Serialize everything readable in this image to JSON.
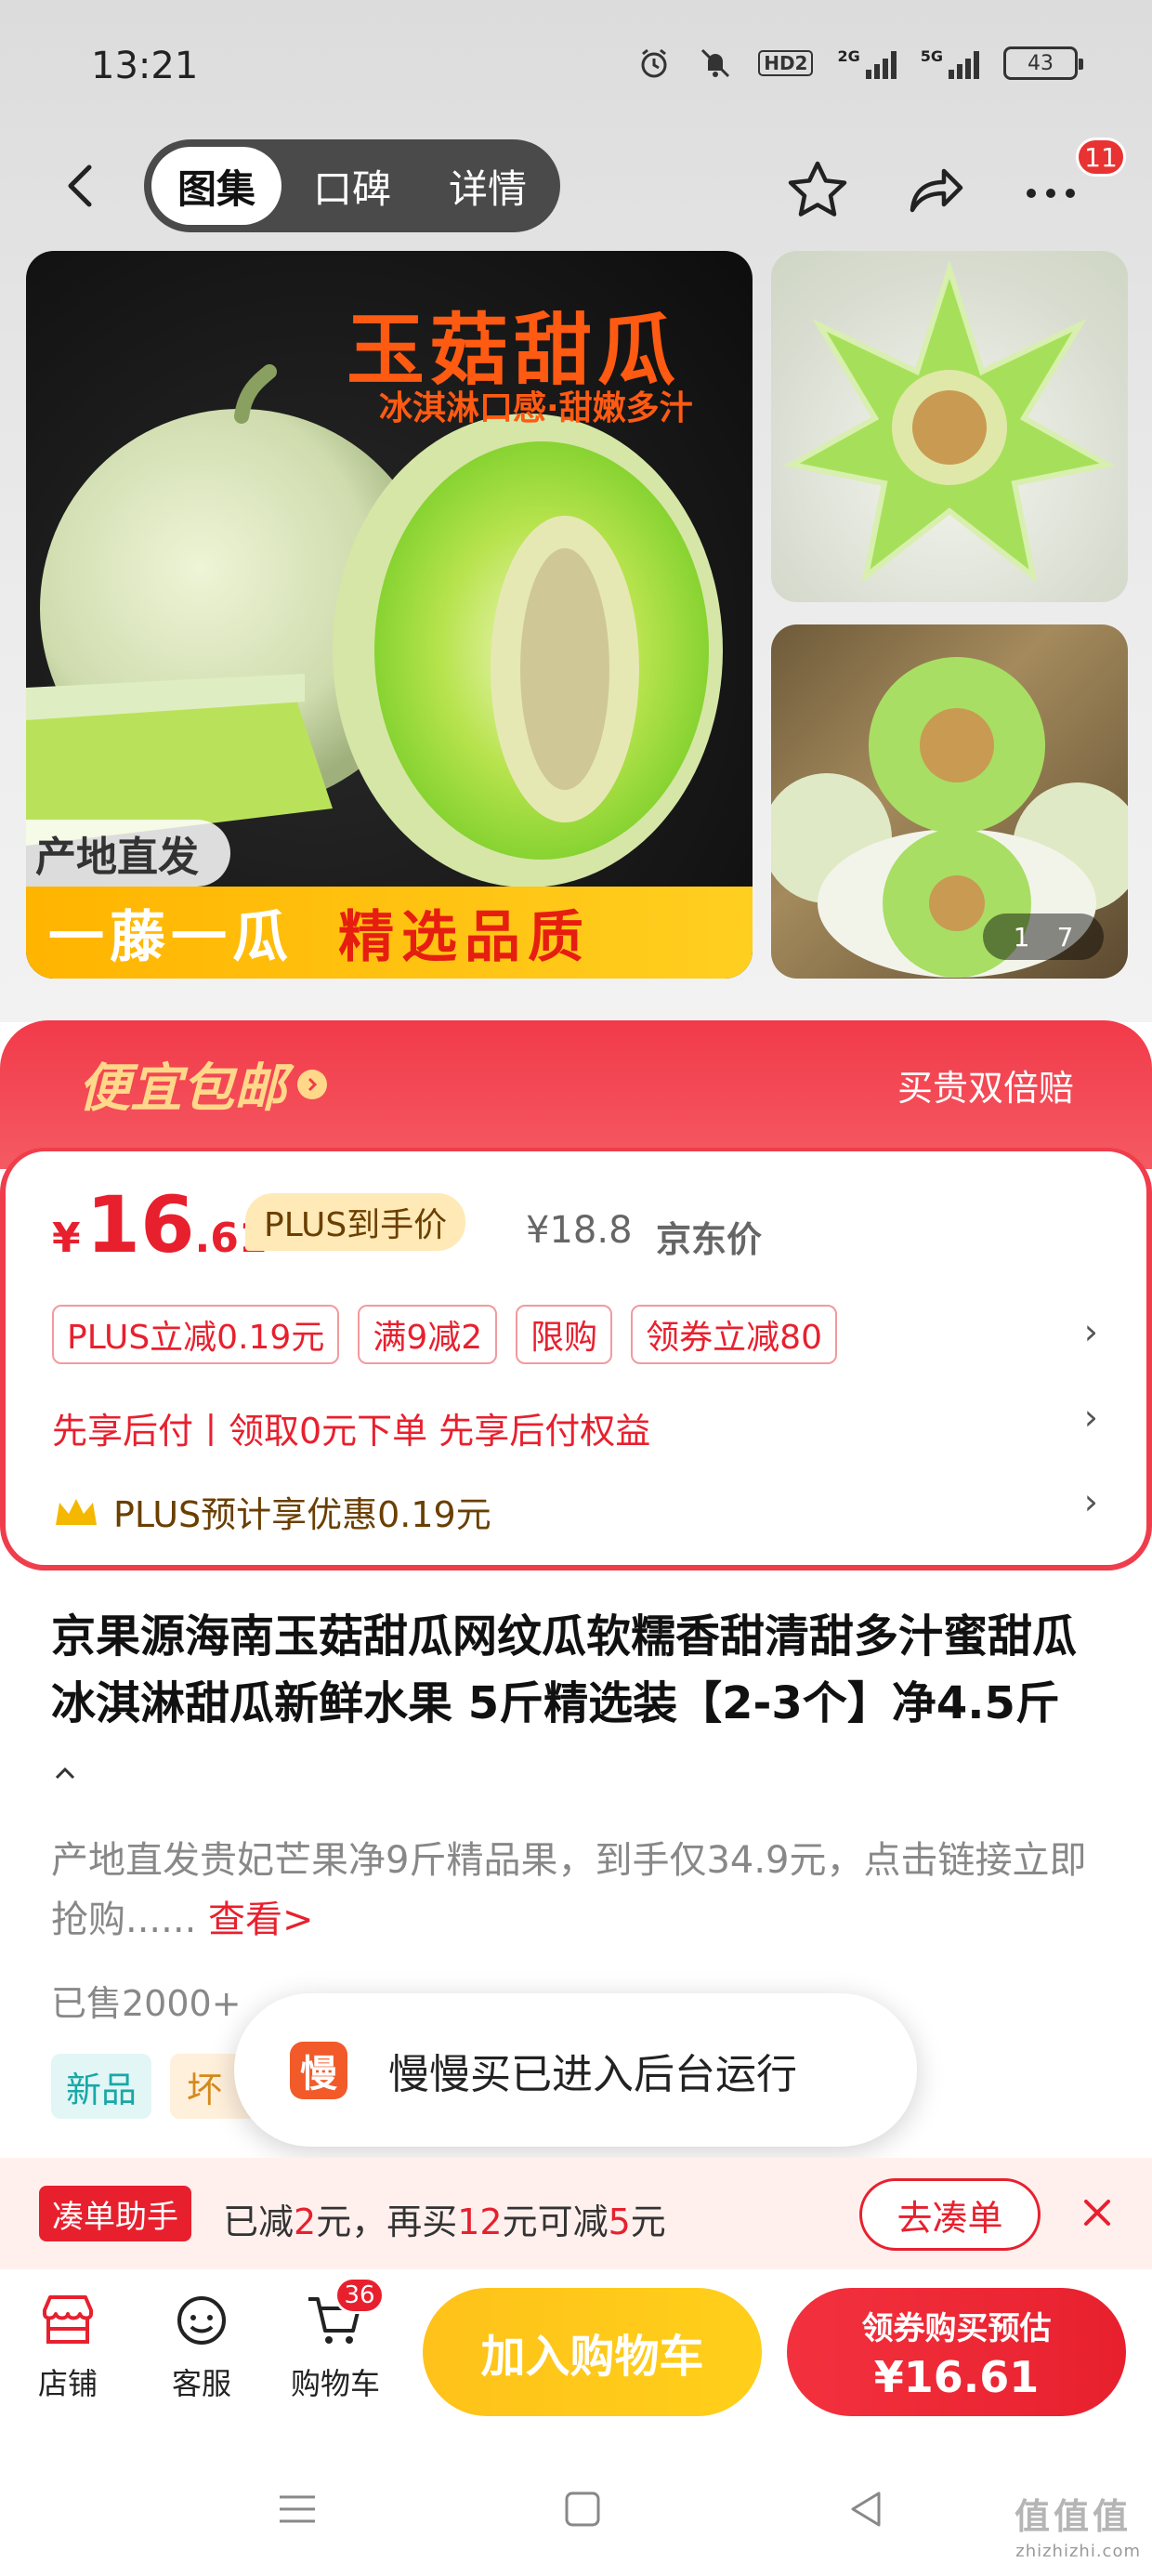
{
  "status_bar": {
    "time": "13:21",
    "hd_label": "HD2",
    "signal1_label": "2G",
    "signal2_label": "5G",
    "battery": "43"
  },
  "nav": {
    "tabs": [
      {
        "label": "图集",
        "active": true
      },
      {
        "label": "口碑",
        "active": false
      },
      {
        "label": "详情",
        "active": false
      }
    ],
    "more_badge": "11"
  },
  "gallery": {
    "main_title": "玉菇甜瓜",
    "main_subtitle": "冰淇淋口感·甜嫩多汁",
    "origin_tag": "产地直发",
    "banner_left": "一藤一瓜",
    "banner_right": "精选品质",
    "counter_current": "1",
    "counter_total": "7"
  },
  "promo": {
    "brand": "便宜包邮",
    "guarantee": "买贵双倍赔",
    "yen": "¥",
    "price_int": "16",
    "price_dec": ".61",
    "plus_tag": "PLUS到手价",
    "orig_price": "¥18.8",
    "orig_label": "京东价",
    "coupons": [
      "PLUS立减0.19元",
      "满9减2",
      "限购",
      "领券立减80"
    ],
    "pay_later": "先享后付丨领取0元下单 先享后付权益",
    "plus_benefit": "PLUS预计享优惠0.19元"
  },
  "product": {
    "title": "京果源海南玉菇甜瓜网纹瓜软糯香甜清甜多汁蜜甜瓜冰淇淋甜瓜新鲜水果 5斤精选装【2-3个】净4.5斤",
    "collapse_icon": "chevron-up",
    "desc": "产地直发贵妃芒果净9斤精品果，到手仅34.9元，点击链接立即抢购......",
    "see_more": "查看>",
    "sold": "已售2000+",
    "tag_new": "新品",
    "tag_other": "坏"
  },
  "toast": {
    "icon_char": "慢",
    "text": "慢慢买已进入后台运行"
  },
  "bundle": {
    "tag": "凑单助手",
    "text_prefix": "已减",
    "reduced": "2",
    "text_mid1": "元，再买",
    "more": "12",
    "text_mid2": "元可减",
    "next_reduce": "5",
    "text_suffix": "元",
    "button": "去凑单"
  },
  "actions": {
    "shop": "店铺",
    "service": "客服",
    "cart": "购物车",
    "cart_badge": "36",
    "add_cart": "加入购物车",
    "buy_top": "领券购买预估",
    "buy_price": "¥16.61"
  },
  "watermark": {
    "logo": "值值值",
    "url": "zhizhizhi.com"
  },
  "colors": {
    "accent_red": "#e8202e",
    "promo_gold": "#ffd88a",
    "add_cart_yellow": "#ffc21a"
  }
}
